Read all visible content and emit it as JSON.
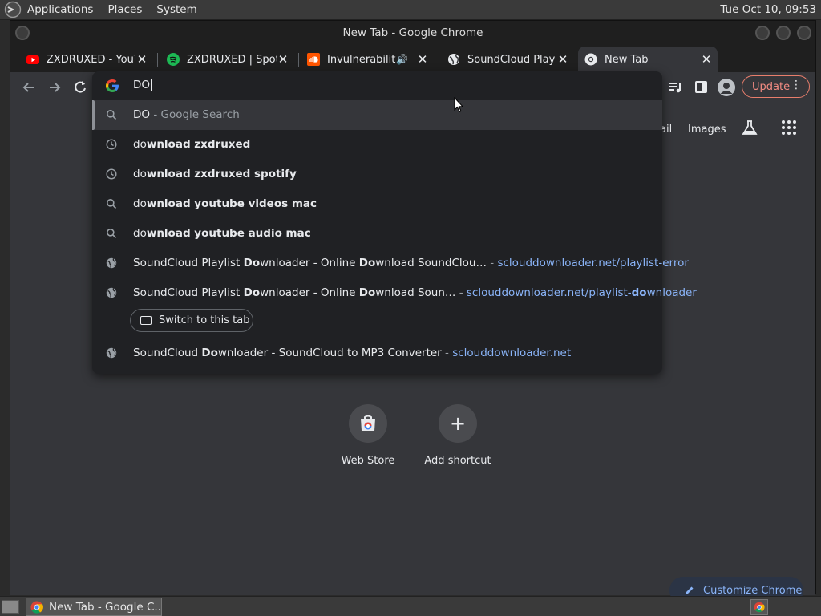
{
  "os_panel": {
    "menus": [
      "Applications",
      "Places",
      "System"
    ],
    "clock": "Tue Oct 10, 09:53"
  },
  "window": {
    "title": "New Tab - Google Chrome"
  },
  "tabs": [
    {
      "title": "ZXDRUXED - YouTu",
      "favicon": "youtube-icon"
    },
    {
      "title": "ZXDRUXED | Spotif",
      "favicon": "spotify-icon"
    },
    {
      "title": "Invulnerability",
      "favicon": "soundcloud-icon",
      "audio": true
    },
    {
      "title": "SoundCloud Playlis",
      "favicon": "globe-icon"
    },
    {
      "title": "New Tab",
      "favicon": "chrome-icon",
      "active": true
    }
  ],
  "toolbar": {
    "update_label": "Update"
  },
  "omnibox": {
    "input_value": "DO",
    "suggestions": [
      {
        "type": "search",
        "selected": true,
        "parts": [
          {
            "t": "DO",
            "s": "plain"
          },
          {
            "t": " - Google Search",
            "s": "muted"
          }
        ]
      },
      {
        "type": "history",
        "parts": [
          {
            "t": "do",
            "s": "plain"
          },
          {
            "t": "wnload zxdruxed",
            "s": "bold"
          }
        ]
      },
      {
        "type": "history",
        "parts": [
          {
            "t": "do",
            "s": "plain"
          },
          {
            "t": "wnload zxdruxed spotify",
            "s": "bold"
          }
        ]
      },
      {
        "type": "search",
        "parts": [
          {
            "t": "do",
            "s": "plain"
          },
          {
            "t": "wnload youtube videos mac",
            "s": "bold"
          }
        ]
      },
      {
        "type": "search",
        "parts": [
          {
            "t": "do",
            "s": "plain"
          },
          {
            "t": "wnload youtube audio mac",
            "s": "bold"
          }
        ]
      },
      {
        "type": "page",
        "parts": [
          {
            "t": "SoundCloud Playlist ",
            "s": "plain"
          },
          {
            "t": "Do",
            "s": "bold"
          },
          {
            "t": "wnloader - Online ",
            "s": "plain"
          },
          {
            "t": "Do",
            "s": "bold"
          },
          {
            "t": "wnload SoundClou…",
            "s": "plain"
          },
          {
            "t": " - ",
            "s": "muted"
          },
          {
            "t": "sclouddownloader.net/playlist-error",
            "s": "url"
          }
        ]
      },
      {
        "type": "page",
        "parts": [
          {
            "t": "SoundCloud Playlist ",
            "s": "plain"
          },
          {
            "t": "Do",
            "s": "bold"
          },
          {
            "t": "wnloader - Online ",
            "s": "plain"
          },
          {
            "t": "Do",
            "s": "bold"
          },
          {
            "t": "wnload Soun…",
            "s": "plain"
          },
          {
            "t": " - ",
            "s": "muted"
          },
          {
            "t": "sclouddownloader.net/playlist-",
            "s": "url"
          },
          {
            "t": "do",
            "s": "urlbold"
          },
          {
            "t": "wnloader",
            "s": "url"
          }
        ]
      },
      {
        "type": "page",
        "parts": [
          {
            "t": "SoundCloud ",
            "s": "plain"
          },
          {
            "t": "Do",
            "s": "bold"
          },
          {
            "t": "wnloader - SoundCloud to MP3 Converter",
            "s": "plain"
          },
          {
            "t": " - ",
            "s": "muted"
          },
          {
            "t": "sclouddownloader.net",
            "s": "url"
          }
        ]
      }
    ],
    "switch_tab_label": "Switch to this tab"
  },
  "ntp": {
    "links": [
      "ail",
      "Images"
    ],
    "shortcuts": [
      {
        "label": "Web Store",
        "icon": "web-store-icon"
      },
      {
        "label": "Add shortcut",
        "icon": "plus-icon"
      }
    ],
    "customize_label": "Customize Chrome"
  },
  "taskbar": {
    "task_label": "New Tab - Google C..."
  },
  "colors": {
    "accent_blue": "#8ab4f8",
    "update_red": "#f28b82",
    "panel_bg": "#35363a",
    "popup_bg": "#202124"
  }
}
